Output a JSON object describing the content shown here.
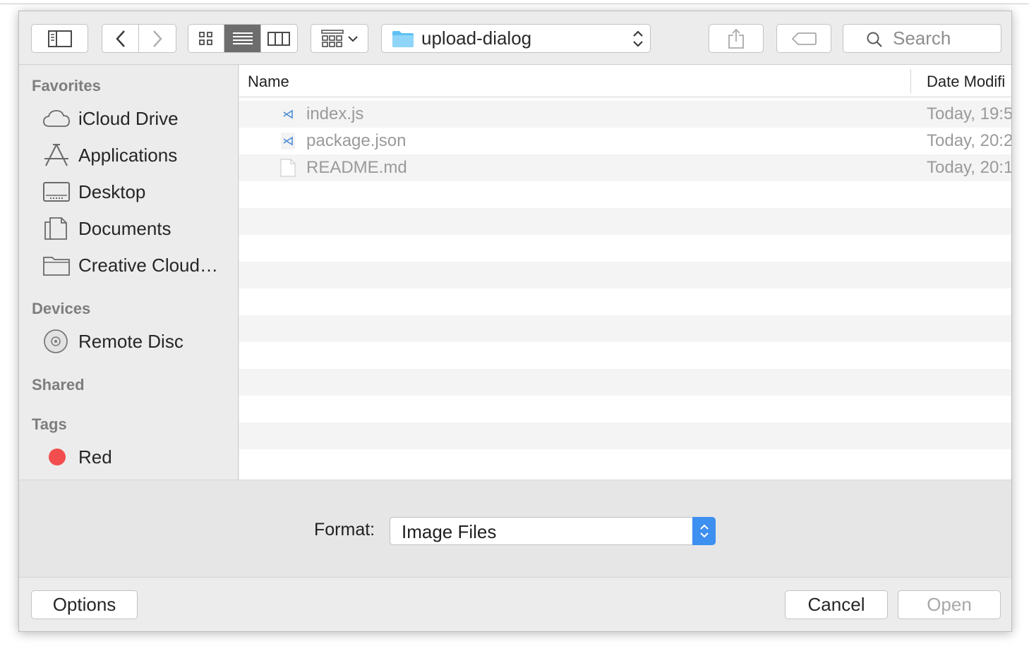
{
  "toolbar": {
    "path": {
      "label": "upload-dialog",
      "icon": "folder-icon",
      "folder_color": "#5ec1f2"
    },
    "search": {
      "placeholder": "Search"
    },
    "view_mode": "list"
  },
  "sidebar": {
    "sections": {
      "favorites": "Favorites",
      "devices": "Devices",
      "shared": "Shared",
      "tags": "Tags"
    },
    "favorites": [
      {
        "label": "iCloud Drive",
        "icon": "cloud-icon"
      },
      {
        "label": "Applications",
        "icon": "applications-icon"
      },
      {
        "label": "Desktop",
        "icon": "desktop-icon"
      },
      {
        "label": "Documents",
        "icon": "documents-icon"
      },
      {
        "label": "Creative Cloud…",
        "icon": "folder-icon"
      }
    ],
    "devices": [
      {
        "label": "Remote Disc",
        "icon": "disc-icon"
      }
    ],
    "tags": [
      {
        "label": "Red",
        "color": "#f24e4e"
      }
    ]
  },
  "file_list": {
    "columns": {
      "name": "Name",
      "date": "Date Modifi"
    },
    "files": [
      {
        "name": "index.js",
        "date": "Today, 19:5",
        "icon": "vscode-file-icon"
      },
      {
        "name": "package.json",
        "date": "Today, 20:2",
        "icon": "vscode-file-icon"
      },
      {
        "name": "README.md",
        "date": "Today, 20:1",
        "icon": "blank-document-icon"
      }
    ]
  },
  "format": {
    "label": "Format:",
    "value": "Image Files",
    "accent": "#3d8ff0"
  },
  "buttons": {
    "options": "Options",
    "cancel": "Cancel",
    "open": "Open"
  }
}
